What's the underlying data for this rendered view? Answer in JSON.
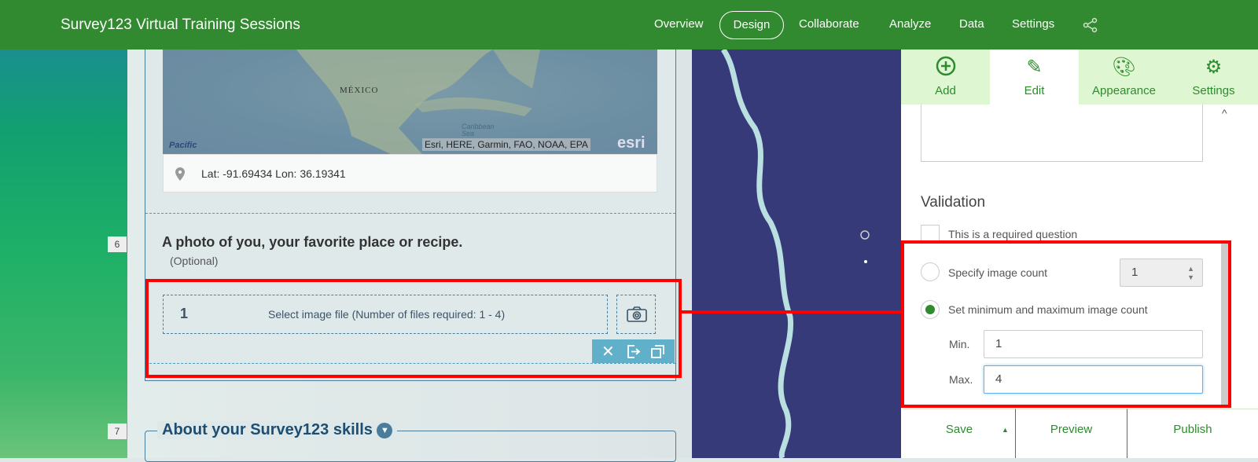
{
  "header": {
    "title": "Survey123 Virtual Training Sessions",
    "nav": [
      "Overview",
      "Design",
      "Collaborate",
      "Analyze",
      "Data",
      "Settings"
    ],
    "active": "Design"
  },
  "map": {
    "country_label": "MÉXICO",
    "ocean_label": "Pacific",
    "sea_label": "Caribbean Sea",
    "attribution": "Esri, HERE, Garmin, FAO, NOAA, EPA",
    "logo": "esri",
    "coords": "Lat: -91.69434 Lon: 36.19341"
  },
  "questions": [
    {
      "number": "6",
      "title": "A photo of you, your favorite place or recipe.",
      "optional": "(Optional)",
      "image_index": "1",
      "image_prompt": "Select image file (Number of files required: 1 - 4)"
    },
    {
      "number": "7",
      "title": "About your Survey123 skills"
    }
  ],
  "panel": {
    "tabs": [
      {
        "label": "Add",
        "icon": "plus-circle-icon"
      },
      {
        "label": "Edit",
        "icon": "pencil-icon"
      },
      {
        "label": "Appearance",
        "icon": "palette-icon"
      },
      {
        "label": "Settings",
        "icon": "settings-doc-icon"
      }
    ],
    "active_tab": "Edit",
    "validation_heading": "Validation",
    "required_label": "This is a required question",
    "specify_label": "Specify image count",
    "specify_value": "1",
    "minmax_label": "Set minimum and maximum image count",
    "min_label": "Min.",
    "min_value": "1",
    "max_label": "Max.",
    "max_value": "4"
  },
  "footer": {
    "save": "Save",
    "preview": "Preview",
    "publish": "Publish"
  },
  "colors": {
    "brand": "#318a2f",
    "highlight": "#ff0000",
    "toolbar": "#5fb0c8"
  }
}
